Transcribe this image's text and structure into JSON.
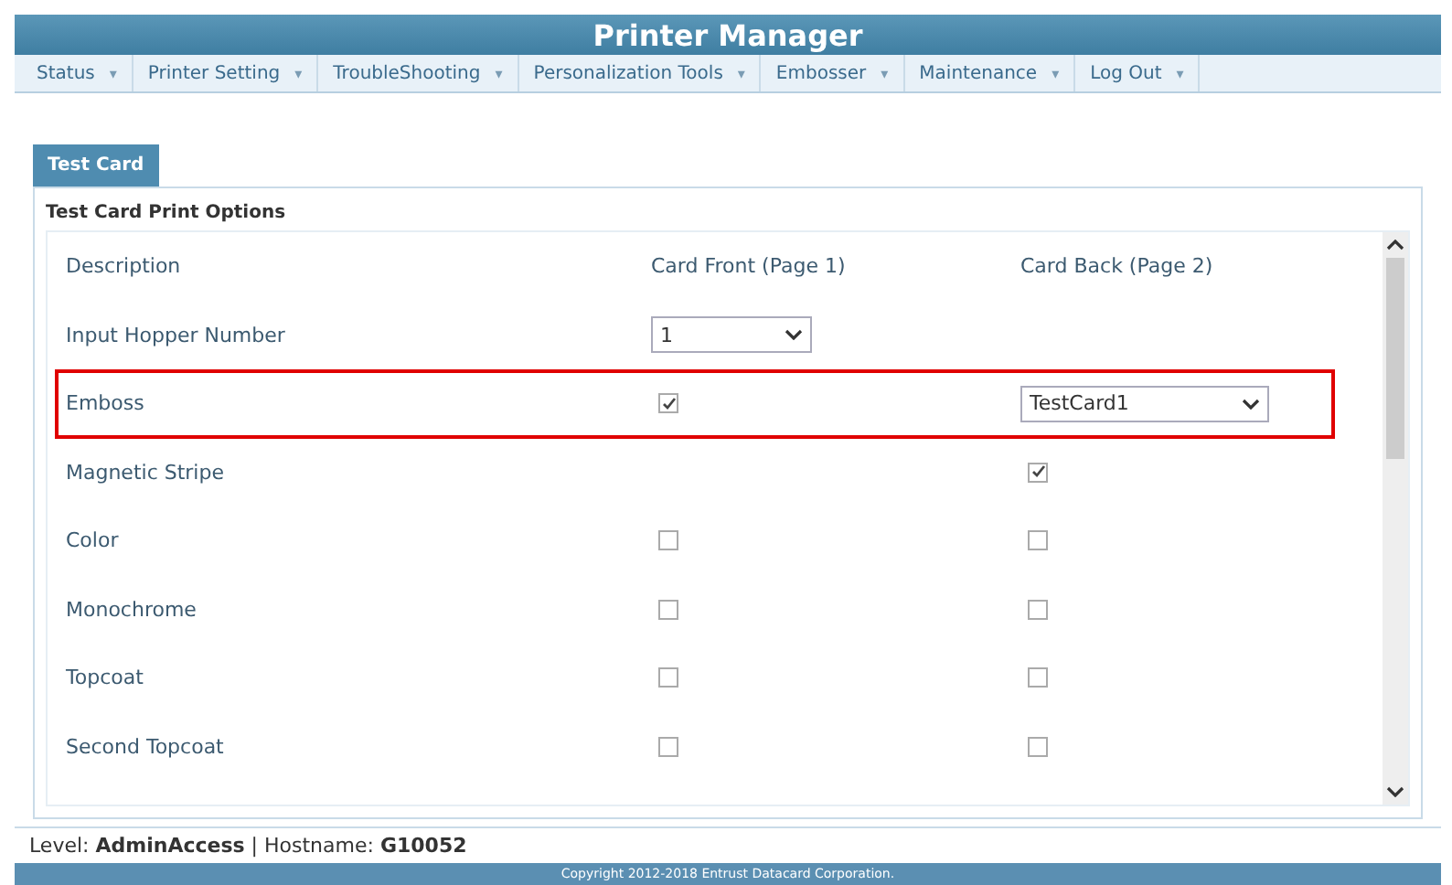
{
  "title": "Printer Manager",
  "menu": [
    {
      "label": "Status",
      "arrow": "▾"
    },
    {
      "label": "Printer Setting",
      "arrow": "▾"
    },
    {
      "label": "TroubleShooting",
      "arrow": "▾"
    },
    {
      "label": "Personalization Tools",
      "arrow": "▾"
    },
    {
      "label": "Embosser",
      "arrow": "▾"
    },
    {
      "label": "Maintenance",
      "arrow": "▾"
    },
    {
      "label": "Log Out",
      "arrow": "▾"
    }
  ],
  "tabs": [
    {
      "label": "Test Card",
      "selected": true
    }
  ],
  "section_title": "Test Card Print Options",
  "columns": [
    "Description",
    "Card Front (Page 1)",
    "Card Back (Page 2)"
  ],
  "rows": [
    {
      "label": "Input Hopper Number",
      "highlighted": false,
      "front": {
        "kind": "select",
        "value": "1"
      }
    },
    {
      "label": "Emboss",
      "highlighted": true,
      "front": {
        "kind": "checkbox",
        "checked": true
      },
      "back": {
        "kind": "select",
        "value": "TestCard1"
      }
    },
    {
      "label": "Magnetic Stripe",
      "highlighted": false,
      "back": {
        "kind": "checkbox",
        "checked": true
      }
    },
    {
      "label": "Color",
      "highlighted": false,
      "front": {
        "kind": "checkbox",
        "checked": false
      },
      "back": {
        "kind": "checkbox",
        "checked": false
      }
    },
    {
      "label": "Monochrome",
      "highlighted": false,
      "front": {
        "kind": "checkbox",
        "checked": false
      },
      "back": {
        "kind": "checkbox",
        "checked": false
      }
    },
    {
      "label": "Topcoat",
      "highlighted": false,
      "front": {
        "kind": "checkbox",
        "checked": false
      },
      "back": {
        "kind": "checkbox",
        "checked": false
      }
    },
    {
      "label": "Second Topcoat",
      "highlighted": false,
      "front": {
        "kind": "checkbox",
        "checked": false
      },
      "back": {
        "kind": "checkbox",
        "checked": false
      }
    }
  ],
  "status": "Level: **AdminAccess** | Hostname: **G10052**",
  "copyright": "Copyright 2012-2018 Entrust Datacard Corporation."
}
